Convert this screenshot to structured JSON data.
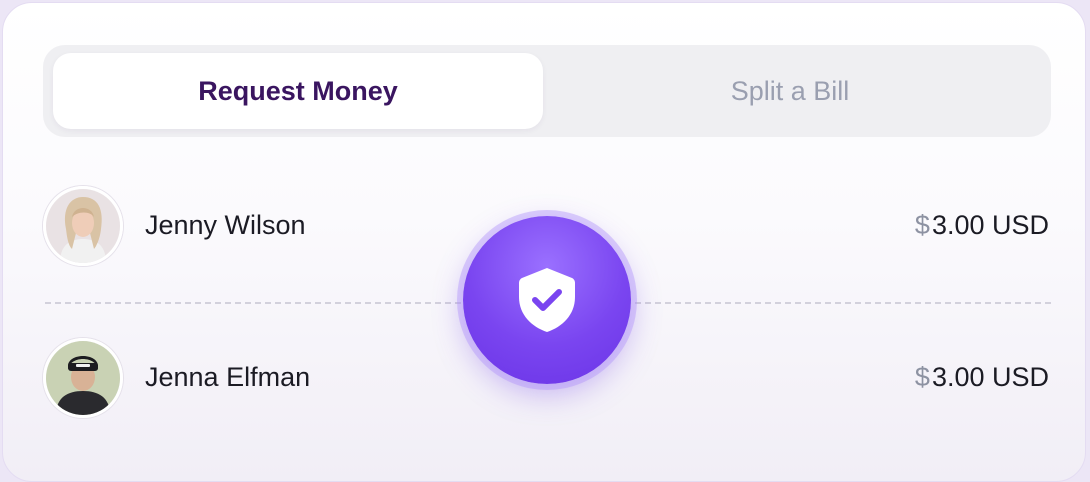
{
  "tabs": {
    "request_label": "Request Money",
    "split_label": "Split a Bill",
    "active": "Request Money"
  },
  "rows": [
    {
      "name": "Jenny Wilson",
      "currency_symbol": "$",
      "amount": "3.00 USD"
    },
    {
      "name": "Jenna Elfman",
      "currency_symbol": "$",
      "amount": "3.00 USD"
    }
  ],
  "badge": {
    "icon": "shield-check-icon"
  },
  "colors": {
    "accent": "#7a45f0",
    "active_tab_text": "#3a1560",
    "inactive_tab_text": "#9a9fb0"
  }
}
